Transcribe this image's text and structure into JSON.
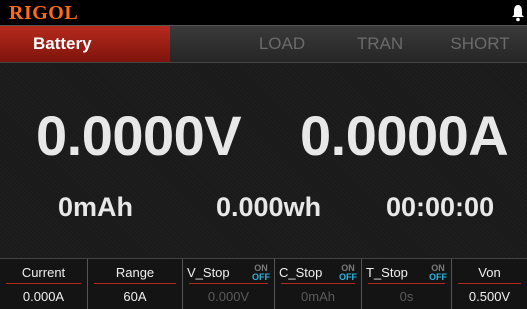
{
  "header": {
    "logo": "RIGOL",
    "bell_icon": "bell-icon"
  },
  "tabs": [
    {
      "label": "Battery",
      "active": true
    },
    {
      "label": "LOAD",
      "active": false
    },
    {
      "label": "TRAN",
      "active": false
    },
    {
      "label": "SHORT",
      "active": false
    }
  ],
  "readings": {
    "voltage": "0.0000V",
    "current": "0.0000A",
    "capacity": "0mAh",
    "energy": "0.000wh",
    "time": "00:00:00"
  },
  "params": [
    {
      "label": "Current",
      "value": "0.000A",
      "dim": false
    },
    {
      "label": "Range",
      "value": "60A",
      "dim": false
    },
    {
      "label": "V_Stop",
      "value": "0.000V",
      "dim": true,
      "on": "ON",
      "off": "OFF"
    },
    {
      "label": "C_Stop",
      "value": "0mAh",
      "dim": true,
      "on": "ON",
      "off": "OFF"
    },
    {
      "label": "T_Stop",
      "value": "0s",
      "dim": true,
      "on": "ON",
      "off": "OFF"
    },
    {
      "label": "Von",
      "value": "0.500V",
      "dim": false
    }
  ],
  "colors": {
    "accent_red": "#b72a1d",
    "logo_orange": "#ff6a1a",
    "off_blue": "#2fb3e0"
  }
}
